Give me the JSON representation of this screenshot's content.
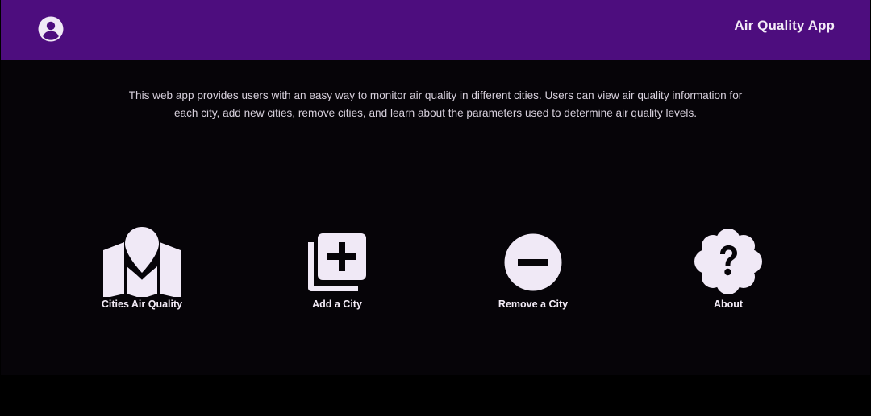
{
  "colors": {
    "header_bg": "#4d0d7e",
    "main_bg": "#060408",
    "icon_fill": "#f0e9f6",
    "text": "#f3ecf7"
  },
  "header": {
    "title": "Air Quality App",
    "profile_icon": "account-circle-icon"
  },
  "main": {
    "description": "This web app provides users with an easy way to monitor air quality in different cities. Users can view air quality information for each city, add new cities, remove cities, and learn about the parameters used to determine air quality levels.",
    "tiles": [
      {
        "label": "Cities Air Quality",
        "icon": "map-pin-icon"
      },
      {
        "label": "Add a City",
        "icon": "library-add-icon"
      },
      {
        "label": "Remove a City",
        "icon": "remove-circle-icon"
      },
      {
        "label": "About",
        "icon": "help-badge-icon"
      }
    ]
  }
}
